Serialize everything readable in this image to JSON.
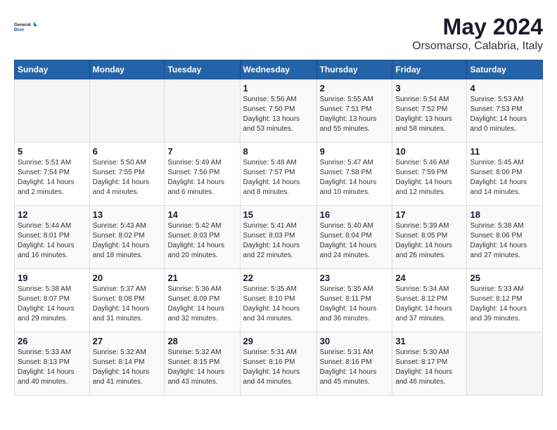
{
  "header": {
    "logo_line1": "General",
    "logo_line2": "Blue",
    "month_year": "May 2024",
    "location": "Orsomarso, Calabria, Italy"
  },
  "weekdays": [
    "Sunday",
    "Monday",
    "Tuesday",
    "Wednesday",
    "Thursday",
    "Friday",
    "Saturday"
  ],
  "weeks": [
    [
      {
        "day": "",
        "info": ""
      },
      {
        "day": "",
        "info": ""
      },
      {
        "day": "",
        "info": ""
      },
      {
        "day": "1",
        "info": "Sunrise: 5:56 AM\nSunset: 7:50 PM\nDaylight: 13 hours\nand 53 minutes."
      },
      {
        "day": "2",
        "info": "Sunrise: 5:55 AM\nSunset: 7:51 PM\nDaylight: 13 hours\nand 55 minutes."
      },
      {
        "day": "3",
        "info": "Sunrise: 5:54 AM\nSunset: 7:52 PM\nDaylight: 13 hours\nand 58 minutes."
      },
      {
        "day": "4",
        "info": "Sunrise: 5:53 AM\nSunset: 7:53 PM\nDaylight: 14 hours\nand 0 minutes."
      }
    ],
    [
      {
        "day": "5",
        "info": "Sunrise: 5:51 AM\nSunset: 7:54 PM\nDaylight: 14 hours\nand 2 minutes."
      },
      {
        "day": "6",
        "info": "Sunrise: 5:50 AM\nSunset: 7:55 PM\nDaylight: 14 hours\nand 4 minutes."
      },
      {
        "day": "7",
        "info": "Sunrise: 5:49 AM\nSunset: 7:56 PM\nDaylight: 14 hours\nand 6 minutes."
      },
      {
        "day": "8",
        "info": "Sunrise: 5:48 AM\nSunset: 7:57 PM\nDaylight: 14 hours\nand 8 minutes."
      },
      {
        "day": "9",
        "info": "Sunrise: 5:47 AM\nSunset: 7:58 PM\nDaylight: 14 hours\nand 10 minutes."
      },
      {
        "day": "10",
        "info": "Sunrise: 5:46 AM\nSunset: 7:59 PM\nDaylight: 14 hours\nand 12 minutes."
      },
      {
        "day": "11",
        "info": "Sunrise: 5:45 AM\nSunset: 8:00 PM\nDaylight: 14 hours\nand 14 minutes."
      }
    ],
    [
      {
        "day": "12",
        "info": "Sunrise: 5:44 AM\nSunset: 8:01 PM\nDaylight: 14 hours\nand 16 minutes."
      },
      {
        "day": "13",
        "info": "Sunrise: 5:43 AM\nSunset: 8:02 PM\nDaylight: 14 hours\nand 18 minutes."
      },
      {
        "day": "14",
        "info": "Sunrise: 5:42 AM\nSunset: 8:03 PM\nDaylight: 14 hours\nand 20 minutes."
      },
      {
        "day": "15",
        "info": "Sunrise: 5:41 AM\nSunset: 8:03 PM\nDaylight: 14 hours\nand 22 minutes."
      },
      {
        "day": "16",
        "info": "Sunrise: 5:40 AM\nSunset: 8:04 PM\nDaylight: 14 hours\nand 24 minutes."
      },
      {
        "day": "17",
        "info": "Sunrise: 5:39 AM\nSunset: 8:05 PM\nDaylight: 14 hours\nand 26 minutes."
      },
      {
        "day": "18",
        "info": "Sunrise: 5:38 AM\nSunset: 8:06 PM\nDaylight: 14 hours\nand 27 minutes."
      }
    ],
    [
      {
        "day": "19",
        "info": "Sunrise: 5:38 AM\nSunset: 8:07 PM\nDaylight: 14 hours\nand 29 minutes."
      },
      {
        "day": "20",
        "info": "Sunrise: 5:37 AM\nSunset: 8:08 PM\nDaylight: 14 hours\nand 31 minutes."
      },
      {
        "day": "21",
        "info": "Sunrise: 5:36 AM\nSunset: 8:09 PM\nDaylight: 14 hours\nand 32 minutes."
      },
      {
        "day": "22",
        "info": "Sunrise: 5:35 AM\nSunset: 8:10 PM\nDaylight: 14 hours\nand 34 minutes."
      },
      {
        "day": "23",
        "info": "Sunrise: 5:35 AM\nSunset: 8:11 PM\nDaylight: 14 hours\nand 36 minutes."
      },
      {
        "day": "24",
        "info": "Sunrise: 5:34 AM\nSunset: 8:12 PM\nDaylight: 14 hours\nand 37 minutes."
      },
      {
        "day": "25",
        "info": "Sunrise: 5:33 AM\nSunset: 8:12 PM\nDaylight: 14 hours\nand 39 minutes."
      }
    ],
    [
      {
        "day": "26",
        "info": "Sunrise: 5:33 AM\nSunset: 8:13 PM\nDaylight: 14 hours\nand 40 minutes."
      },
      {
        "day": "27",
        "info": "Sunrise: 5:32 AM\nSunset: 8:14 PM\nDaylight: 14 hours\nand 41 minutes."
      },
      {
        "day": "28",
        "info": "Sunrise: 5:32 AM\nSunset: 8:15 PM\nDaylight: 14 hours\nand 43 minutes."
      },
      {
        "day": "29",
        "info": "Sunrise: 5:31 AM\nSunset: 8:16 PM\nDaylight: 14 hours\nand 44 minutes."
      },
      {
        "day": "30",
        "info": "Sunrise: 5:31 AM\nSunset: 8:16 PM\nDaylight: 14 hours\nand 45 minutes."
      },
      {
        "day": "31",
        "info": "Sunrise: 5:30 AM\nSunset: 8:17 PM\nDaylight: 14 hours\nand 46 minutes."
      },
      {
        "day": "",
        "info": ""
      }
    ]
  ]
}
